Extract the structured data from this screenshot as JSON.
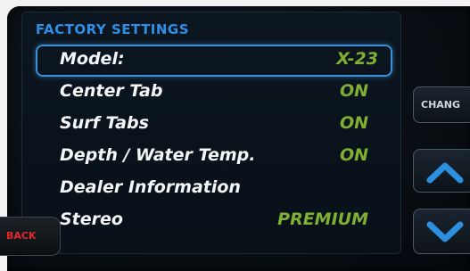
{
  "header": {
    "title": "FACTORY SETTINGS"
  },
  "settings": [
    {
      "label": "Model:",
      "value": "X-23",
      "selected": true
    },
    {
      "label": "Center Tab",
      "value": "ON"
    },
    {
      "label": "Surf Tabs",
      "value": "ON"
    },
    {
      "label": "Depth / Water Temp.",
      "value": "ON"
    },
    {
      "label": "Dealer Information",
      "value": ""
    },
    {
      "label": "Stereo",
      "value": "PREMIUM"
    }
  ],
  "buttons": {
    "change_label": "CHANG",
    "back_label": "BACK",
    "up_icon": "chevron-up-icon",
    "down_icon": "chevron-down-icon"
  },
  "colors": {
    "accent": "#2f8fe6",
    "value_green": "#7fb034",
    "back_red": "#e0262b"
  }
}
